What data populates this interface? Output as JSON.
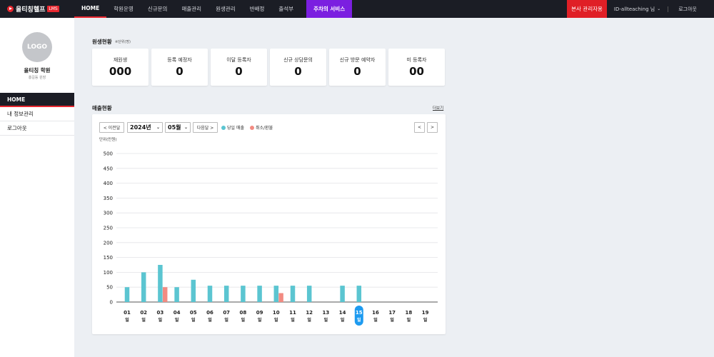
{
  "header": {
    "brand_name": "올티칭헬프",
    "brand_badge": "LMS",
    "nav": [
      "HOME",
      "학원운영",
      "신규문의",
      "매출관리",
      "원생관리",
      "반배정",
      "출석부"
    ],
    "special_menu": "주차의 서비스",
    "admin_button": "본사 관리자용",
    "user_id": "ID-allteaching 님",
    "logout": "로그아웃"
  },
  "sidebar": {
    "logo_text": "LOGO",
    "academy_name": "올티칭 학원",
    "academy_role": "홍길동 원장",
    "menu": [
      "HOME",
      "내 정보관리",
      "로그아웃"
    ]
  },
  "status": {
    "title": "원생현황",
    "unit_note": "※단위(명)",
    "cards": [
      {
        "label": "재원생",
        "value": "000"
      },
      {
        "label": "등록 예정자",
        "value": "0"
      },
      {
        "label": "이달 등록자",
        "value": "0"
      },
      {
        "label": "신규 상담문의",
        "value": "0"
      },
      {
        "label": "신규 방문 예약자",
        "value": "0"
      },
      {
        "label": "미 등록자",
        "value": "00"
      }
    ]
  },
  "sales": {
    "title": "매출현황",
    "more": "더보기",
    "prev_month": "< 이전달",
    "year": "2024년",
    "month": "05월",
    "next_month": "다음달 >",
    "legend_sales": "당일 매출",
    "legend_refund": "취소/환불",
    "unit": "단위(만원)",
    "prev_arrow": "<",
    "next_arrow": ">"
  },
  "colors": {
    "sales": "#5bc5d1",
    "refund": "#f28b82",
    "highlight": "#1e9bf0",
    "accent": "#e8272f",
    "special": "#7b1fe0"
  },
  "chart_data": {
    "type": "bar",
    "ylabel": "단위(만원)",
    "ylim": [
      0,
      500
    ],
    "y_ticks": [
      0,
      50,
      100,
      150,
      200,
      250,
      300,
      350,
      400,
      450,
      500
    ],
    "categories": [
      "01",
      "02",
      "03",
      "04",
      "05",
      "06",
      "07",
      "08",
      "09",
      "10",
      "11",
      "12",
      "13",
      "14",
      "15",
      "16",
      "17",
      "18",
      "19"
    ],
    "category_suffix": "일",
    "highlight_category": "15",
    "series": [
      {
        "name": "당일 매출",
        "color": "#5bc5d1",
        "values": [
          50,
          100,
          125,
          50,
          75,
          55,
          55,
          55,
          55,
          55,
          55,
          55,
          0,
          55,
          55,
          0,
          0,
          0,
          0
        ]
      },
      {
        "name": "취소/환불",
        "color": "#f28b82",
        "values": [
          0,
          0,
          50,
          0,
          0,
          0,
          0,
          0,
          0,
          30,
          0,
          0,
          0,
          0,
          0,
          0,
          0,
          0,
          0
        ]
      }
    ]
  }
}
